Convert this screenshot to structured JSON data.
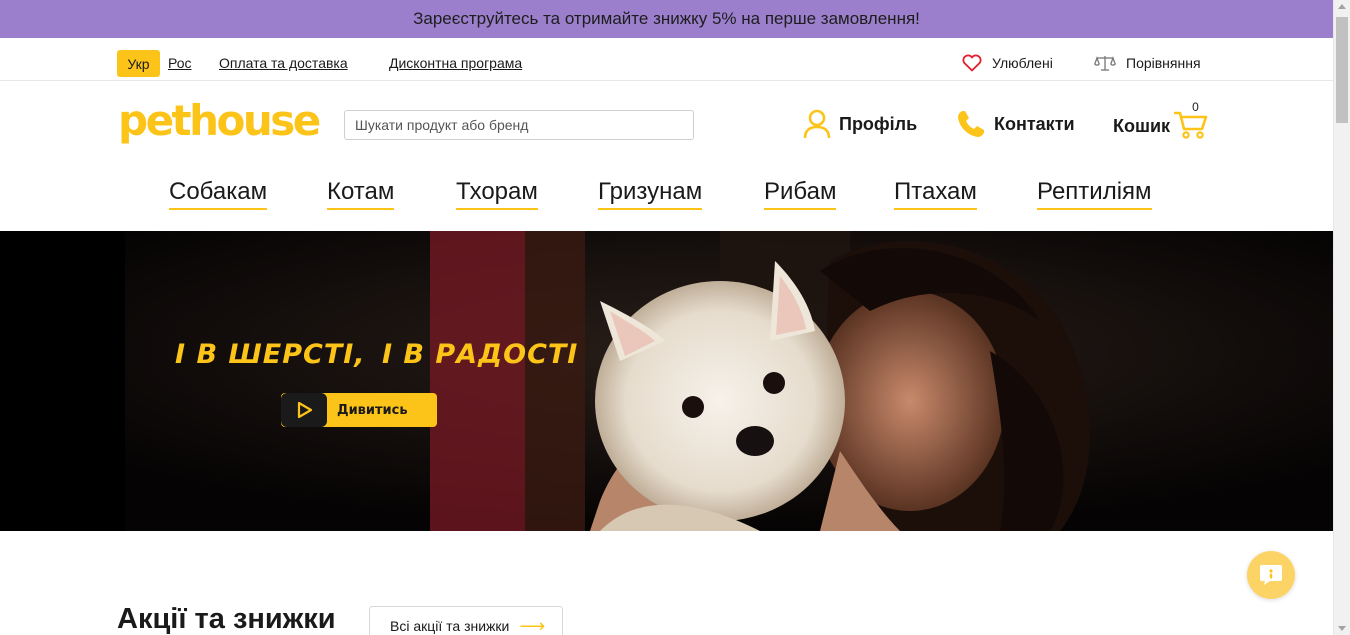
{
  "promo": {
    "text": "Зареєструйтесь та отримайте знижку 5% на перше замовлення!"
  },
  "topbar": {
    "lang_active": "Укр",
    "lang_other": "Рос",
    "delivery": "Оплата та доставка",
    "discount": "Дисконтна програма",
    "favorites": "Улюблені",
    "compare": "Порівняння"
  },
  "header": {
    "logo": "pethouse",
    "search_placeholder": "Шукати продукт або бренд",
    "profile": "Профіль",
    "contacts": "Контакти",
    "cart": "Кошик",
    "cart_count": "0"
  },
  "nav": {
    "items": [
      "Собакам",
      "Котам",
      "Тхорам",
      "Гризунам",
      "Рибам",
      "Птахам",
      "Рептиліям"
    ]
  },
  "hero": {
    "headline_1": "І В ШЕРСТІ,",
    "headline_2": "І В РАДОСТІ",
    "button": "Дивитись"
  },
  "promos": {
    "title": "Акції та знижки",
    "all_link": "Всі акції та знижки"
  },
  "colors": {
    "accent": "#fcc419",
    "promo_bg": "#9b7fcc"
  }
}
